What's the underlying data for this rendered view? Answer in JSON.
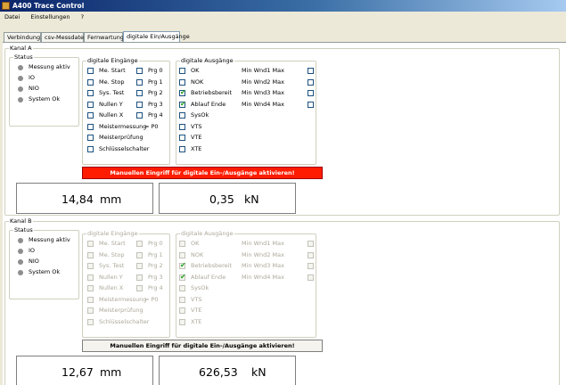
{
  "window": {
    "title": "A400 Trace Control"
  },
  "menu": {
    "items": [
      "Datei",
      "Einstellungen",
      "?"
    ]
  },
  "tabs": [
    "Verbindung",
    "csv-Messdatei",
    "Fernwartung",
    "digitale Ein/Ausgänge"
  ],
  "active_tab": "digitale Ein/Ausgänge",
  "channel_a": {
    "title": "Kanal A",
    "status": {
      "title": "Status",
      "items": [
        "Messung aktiv",
        "IO",
        "NIO",
        "System Ok"
      ]
    },
    "inputs": {
      "title": "digitale Eingänge",
      "left": [
        "Me. Start",
        "Me. Stop",
        "Sys. Test",
        "Nullen Y",
        "Nullen X",
        "Meistermessung",
        "Meisterprüfung",
        "Schlüsselschalter"
      ],
      "right": [
        "Prg 0",
        "Prg 1",
        "Prg 2",
        "Prg 3",
        "Prg 4"
      ],
      "p0_label": "= P0"
    },
    "outputs": {
      "title": "digitale Ausgänge",
      "left": [
        "OK",
        "NOK",
        "Betriebsbereit",
        "Ablauf Ende",
        "SysOk",
        "VTS",
        "VTE",
        "XTE"
      ],
      "left_checked": [
        false,
        false,
        true,
        true,
        false,
        false,
        false,
        false
      ],
      "right": [
        "Min Wnd1 Max",
        "Min Wnd2 Max",
        "Min Wnd3 Max",
        "Min Wnd4 Max"
      ]
    },
    "manual_button": "Manuellen Eingriff für digitale Ein-/Ausgänge aktivieren!",
    "readout1": {
      "value": "14,84",
      "unit": "mm"
    },
    "readout2": {
      "value": "0,35",
      "unit": "kN"
    }
  },
  "channel_b": {
    "title": "Kanal B",
    "status": {
      "title": "Status",
      "items": [
        "Messung aktiv",
        "IO",
        "NIO",
        "System Ok"
      ]
    },
    "inputs": {
      "title": "digitale Eingänge",
      "left": [
        "Me. Start",
        "Me. Stop",
        "Sys. Test",
        "Nullen Y",
        "Nullen X",
        "Meistermessung",
        "Meisterprüfung",
        "Schlüsselschalter"
      ],
      "right": [
        "Prg 0",
        "Prg 1",
        "Prg 2",
        "Prg 3",
        "Prg 4"
      ],
      "p0_label": "= P0"
    },
    "outputs": {
      "title": "digitale Ausgänge",
      "left": [
        "OK",
        "NOK",
        "Betriebsbereit",
        "Ablauf Ende",
        "SysOk",
        "VTS",
        "VTE",
        "XTE"
      ],
      "left_checked": [
        false,
        false,
        true,
        true,
        false,
        false,
        false,
        false
      ],
      "right": [
        "Min Wnd1 Max",
        "Min Wnd2 Max",
        "Min Wnd3 Max",
        "Min Wnd4 Max"
      ]
    },
    "manual_button": "Manuellen Eingriff für digitale Ein-/Ausgänge aktivieren!",
    "readout1": {
      "value": "12,67",
      "unit": "mm"
    },
    "readout2": {
      "value": "626,53",
      "unit": "kN"
    }
  },
  "colors": {
    "accent_red": "#ff1c00",
    "check_green": "#21a121",
    "led_grey": "#8d8d8d",
    "title_blue": "#0a246a"
  }
}
